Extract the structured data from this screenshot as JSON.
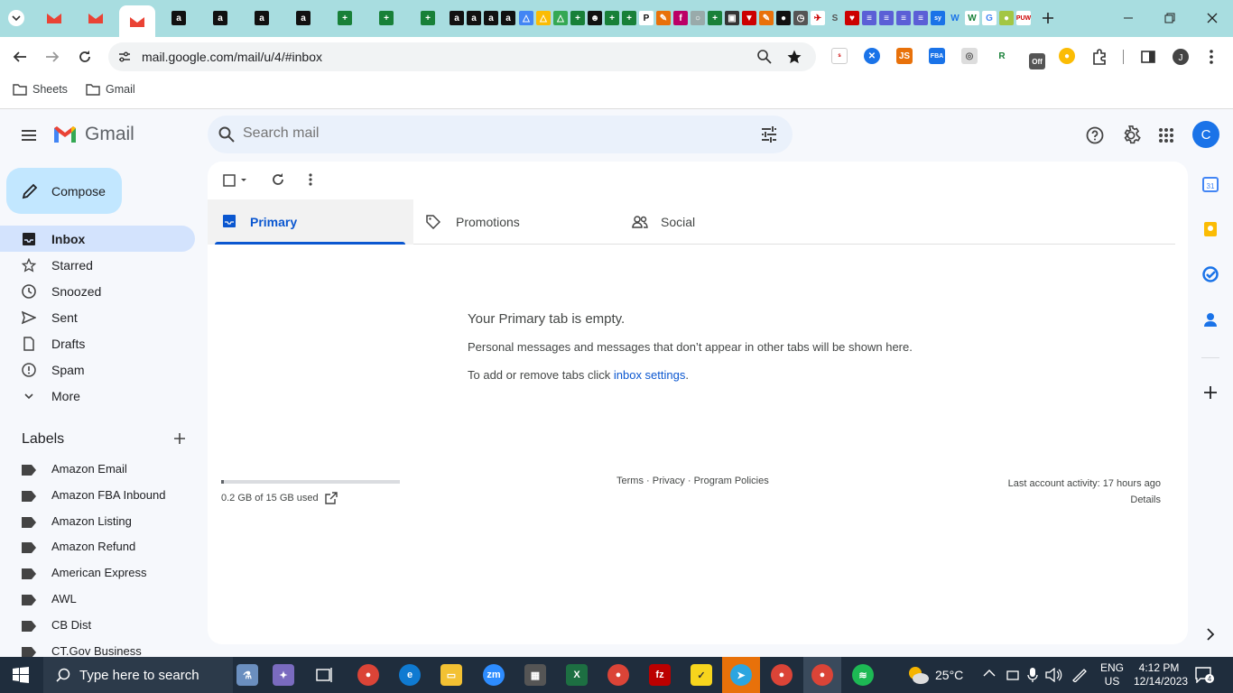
{
  "browser": {
    "url": "mail.google.com/mail/u/4/#inbox",
    "bookmarks": [
      "Sheets",
      "Gmail"
    ]
  },
  "gmail": {
    "logo_text": "Gmail",
    "search_placeholder": "Search mail",
    "avatar_letter": "C",
    "compose_label": "Compose",
    "nav": [
      {
        "label": "Inbox",
        "icon": "inbox-icon"
      },
      {
        "label": "Starred",
        "icon": "star-icon"
      },
      {
        "label": "Snoozed",
        "icon": "clock-icon"
      },
      {
        "label": "Sent",
        "icon": "send-icon"
      },
      {
        "label": "Drafts",
        "icon": "draft-icon"
      },
      {
        "label": "Spam",
        "icon": "spam-icon"
      },
      {
        "label": "More",
        "icon": "chevron-down-icon"
      }
    ],
    "labels_heading": "Labels",
    "labels": [
      "Amazon Email",
      "Amazon FBA Inbound",
      "Amazon Listing",
      "Amazon Refund",
      "American Express",
      "AWL",
      "CB Dist",
      "CT.Gov Business"
    ],
    "tabs": [
      {
        "label": "Primary"
      },
      {
        "label": "Promotions"
      },
      {
        "label": "Social"
      }
    ],
    "empty": {
      "title": "Your Primary tab is empty.",
      "subtitle": "Personal messages and messages that don’t appear in other tabs will be shown here.",
      "hint_prefix": "To add or remove tabs click ",
      "hint_link": "inbox settings",
      "hint_suffix": "."
    },
    "storage": {
      "text": "0.2 GB of 15 GB used",
      "fraction": 0.013
    },
    "footer": {
      "terms": "Terms",
      "privacy": "Privacy",
      "policies": "Program Policies",
      "sep": " · "
    },
    "activity": {
      "text": "Last account activity: 17 hours ago",
      "details": "Details"
    }
  },
  "taskbar": {
    "search_placeholder": "Type here to search",
    "weather": "25°C",
    "lang": "ENG",
    "region": "US",
    "time": "4:12 PM",
    "date": "12/14/2023",
    "notifications": "4"
  },
  "colors": {
    "accent": "#0b57d0",
    "compose": "#c2e7ff",
    "active_nav": "#d3e3fd",
    "tabstrip": "#a8dde0"
  }
}
